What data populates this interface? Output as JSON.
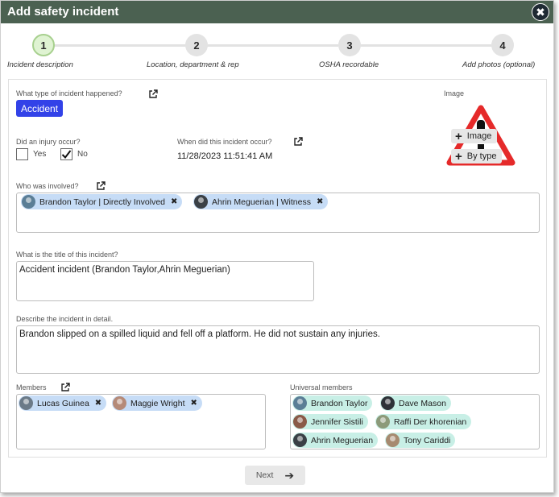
{
  "dialog": {
    "title": "Add safety incident",
    "close_glyph": "✖"
  },
  "stepper": {
    "steps": [
      {
        "number": "1",
        "label": "Incident description",
        "active": true
      },
      {
        "number": "2",
        "label": "Location, department & rep",
        "active": false
      },
      {
        "number": "3",
        "label": "OSHA recordable",
        "active": false
      },
      {
        "number": "4",
        "label": "Add photos (optional)",
        "active": false
      }
    ]
  },
  "form": {
    "type_label": "What type of incident happened?",
    "type_value": "Accident",
    "image_label": "Image",
    "image_buttons": {
      "image": "Image",
      "by_type": "By type"
    },
    "injury_label": "Did an injury occur?",
    "injury_yes": "Yes",
    "injury_no": "No",
    "injury_selected": "No",
    "when_label": "When did this incident occur?",
    "when_value": "11/28/2023 11:51:41 AM",
    "involved_label": "Who was involved?",
    "involved": [
      {
        "name": "Brandon Taylor | Directly Involved",
        "avatar_color": "#5b7e96"
      },
      {
        "name": "Ahrin Meguerian | Witness",
        "avatar_color": "#3a4046"
      }
    ],
    "title_label": "What is the title of this incident?",
    "title_value": "Accident incident (Brandon Taylor,Ahrin Meguerian)",
    "detail_label": "Describe the incident in detail.",
    "detail_value": "Brandon slipped on a spilled liquid and fell off a platform. He did not sustain any injuries.",
    "members_label": "Members",
    "members": [
      {
        "name": "Lucas Guinea",
        "avatar_color": "#6b7a88"
      },
      {
        "name": "Maggie Wright",
        "avatar_color": "#b58a78"
      }
    ],
    "universal_label": "Universal members",
    "universal_members": [
      {
        "name": "Brandon Taylor",
        "avatar_color": "#5b7e96"
      },
      {
        "name": "Dave Mason",
        "avatar_color": "#2e3238"
      },
      {
        "name": "Jennifer Sistili",
        "avatar_color": "#8a5a48"
      },
      {
        "name": "Raffi Der khorenian",
        "avatar_color": "#8c9a7a"
      },
      {
        "name": "Ahrin Meguerian",
        "avatar_color": "#3a4046"
      },
      {
        "name": "Tony Cariddi",
        "avatar_color": "#a68a70"
      }
    ]
  },
  "footer": {
    "next_label": "Next",
    "next_arrow": "➔"
  },
  "colors": {
    "titlebar": "#4b6151",
    "accent_badge": "#3242e8",
    "chip_blue": "#c6dcf6",
    "chip_green": "#c8efe6",
    "warning_red": "#e52a2a"
  }
}
